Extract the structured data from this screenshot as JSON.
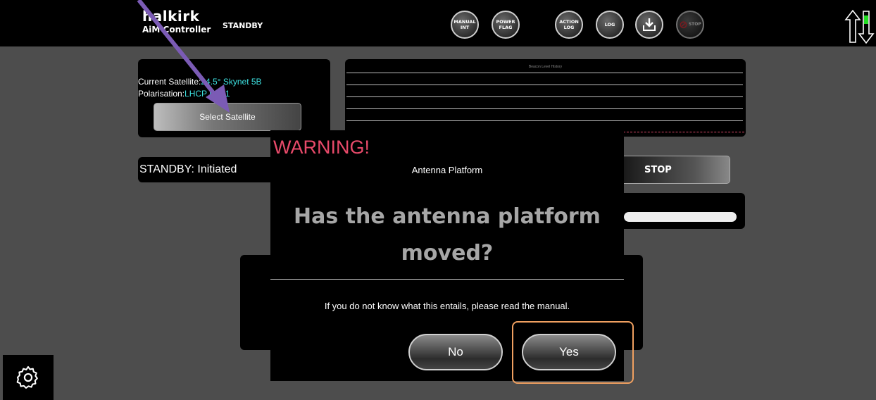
{
  "topbar": {
    "brand": "halkirk",
    "product": "AiM Controller",
    "state": "STANDBY",
    "buttons": [
      {
        "line1": "MANUAL",
        "line2": "INT"
      },
      {
        "line1": "POWER",
        "line2": "FLAG"
      },
      {
        "line1": "ACTION",
        "line2": "LOG"
      },
      {
        "line1": "LOG",
        "line2": ""
      }
    ],
    "stop_label": "STOP"
  },
  "satellite": {
    "current_label": "Current Satellite:",
    "current_value": "24.5° Skynet 5B",
    "polarisation_label": "Polarisation:",
    "polarisation_value": "LHCP",
    "lo_label": " LO: ",
    "lo_value": "1",
    "select_button": "Select Satellite"
  },
  "beacon": {
    "title": "Beacon Level History"
  },
  "status": {
    "text": "STANDBY: Initiated",
    "stop_button": "STOP"
  },
  "progress": {
    "fill_fraction": 1.0
  },
  "modal": {
    "warning": "WARNING!",
    "subtitle": "Antenna Platform",
    "question": "Has the antenna platform moved?",
    "note": "If you do not know what this entails, please read the manual.",
    "no_button": "No",
    "yes_button": "Yes"
  },
  "colors": {
    "background": "#4d4d4d",
    "accent_cyan": "#3de0e0",
    "warning_red": "#e84a6a",
    "highlight_orange": "#f0a060",
    "cursor_purple": "#7b5bb5",
    "battery_green": "#22dd22"
  },
  "icons": {
    "settings": "gear-icon",
    "download": "download-icon",
    "stop": "stop-icon",
    "transfer": "up-down-arrows-icon"
  }
}
